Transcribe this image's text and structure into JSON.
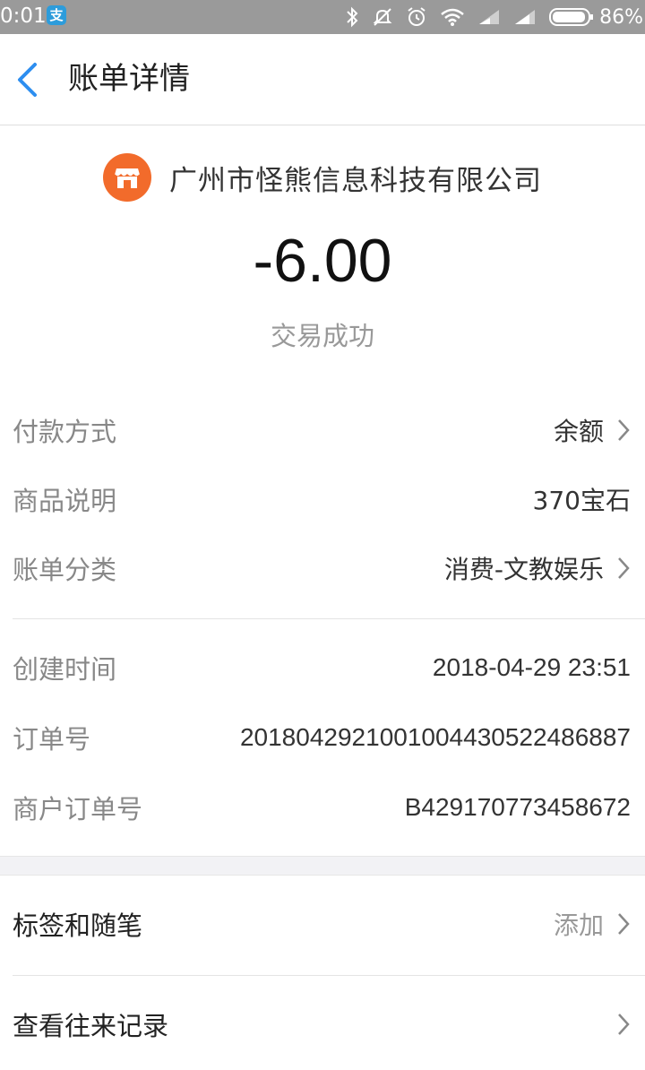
{
  "status_bar": {
    "time": "0:01",
    "app_badge": "支",
    "battery": "86%"
  },
  "nav": {
    "title": "账单详情"
  },
  "merchant": {
    "name": "广州市怪熊信息科技有限公司"
  },
  "amount": "-6.00",
  "transaction_status": "交易成功",
  "details": [
    {
      "label": "付款方式",
      "value": "余额",
      "has_arrow": true
    },
    {
      "label": "商品说明",
      "value": "370宝石",
      "has_arrow": false
    },
    {
      "label": "账单分类",
      "value": "消费-文教娱乐",
      "has_arrow": true
    }
  ],
  "order_info": [
    {
      "label": "创建时间",
      "value": "2018-04-29 23:51"
    },
    {
      "label": "订单号",
      "value": "2018042921001004430522486887"
    },
    {
      "label": "商户订单号",
      "value": "B429170773458672"
    }
  ],
  "actions": {
    "tags": {
      "label": "标签和随笔",
      "value": "添加"
    },
    "history": {
      "label": "查看往来记录"
    }
  },
  "colors": {
    "accent": "#2d8ef0",
    "shop_icon": "#f26b2b"
  }
}
